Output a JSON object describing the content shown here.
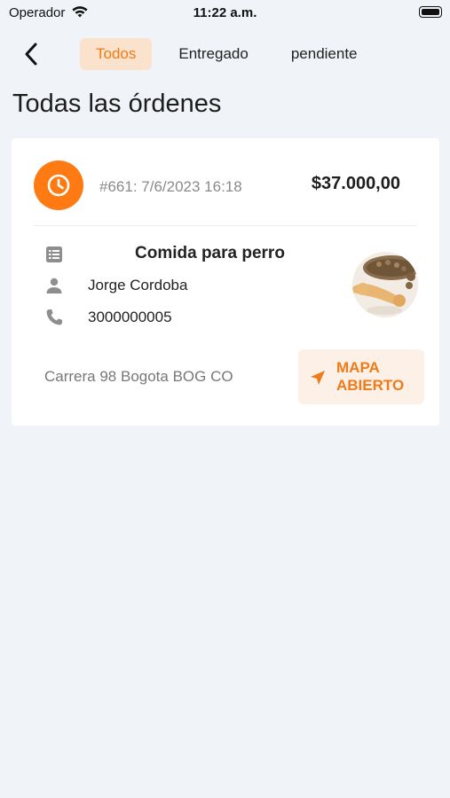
{
  "status_bar": {
    "carrier": "Operador",
    "time": "11:22 a.m."
  },
  "nav": {
    "tabs": [
      {
        "label": "Todos",
        "active": true
      },
      {
        "label": "Entregado",
        "active": false
      },
      {
        "label": "pendiente",
        "active": false
      }
    ]
  },
  "page": {
    "title": "Todas las órdenes"
  },
  "order": {
    "id_datetime": "#661: 7/6/2023 16:18",
    "total": "$37.000,00",
    "product": "Comida para perro",
    "customer": "Jorge Cordoba",
    "phone": "3000000005",
    "address": "Carrera 98 Bogota BOG CO",
    "map_button_label": "MAPA ABIERTO",
    "status_icon": "clock-icon"
  },
  "colors": {
    "accent": "#ff7a12",
    "accent_text": "#f07a17",
    "tab_active_bg": "#fbe2cc",
    "background": "#f0f3f7"
  }
}
